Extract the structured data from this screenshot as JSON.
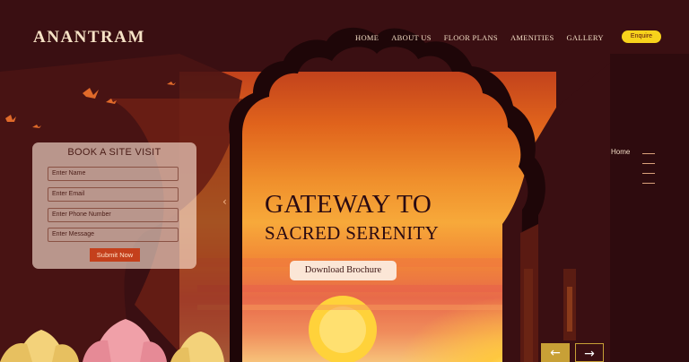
{
  "brand": {
    "logo_text": "ANANTRAM"
  },
  "nav": {
    "items": [
      "HOME",
      "ABOUT US",
      "FLOOR PLANS",
      "AMENITIES",
      "GALLERY"
    ],
    "enquire_label": "Enquire"
  },
  "form": {
    "title": "BOOK A SITE VISIT",
    "fields": [
      {
        "placeholder": "Enter Name"
      },
      {
        "placeholder": "Enter Email"
      },
      {
        "placeholder": "Enter Phone Number"
      },
      {
        "placeholder": "Enter Message"
      }
    ],
    "submit_label": "Submit Now"
  },
  "hero": {
    "headline_line1": "GATEWAY TO",
    "headline_line2": "SACRED SERENITY",
    "cta_label": "Download Brochure"
  },
  "side_nav": {
    "label": "Home"
  },
  "slider": {
    "prev_symbol": "←",
    "next_symbol": "→",
    "hero_prev_symbol": "‹"
  },
  "colors": {
    "background": "#3a0f12",
    "accent_yellow": "#f7d21c",
    "submit_red": "#c4401c",
    "text_cream": "#f6e3c6"
  }
}
